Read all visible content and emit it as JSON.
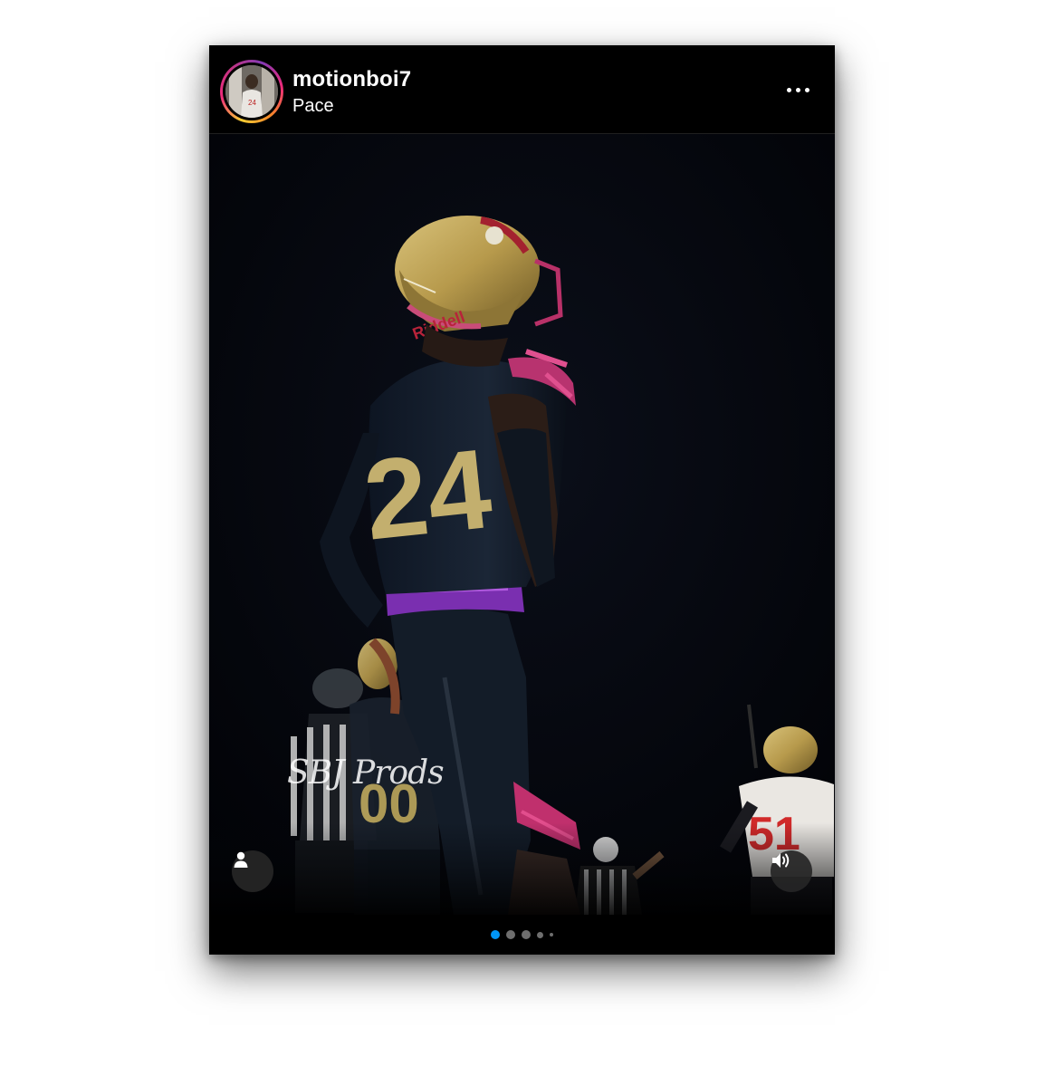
{
  "post": {
    "username": "motionboi7",
    "subtitle": "Pace",
    "more_icon": "more-horizontal-icon",
    "media": {
      "watermark": "SBJ Prods",
      "jersey_number": "24"
    },
    "tag_icon": "user-tag-icon",
    "sound_icon": "speaker-icon",
    "carousel": {
      "total": 5,
      "active_index": 0,
      "active_color": "#0095f6",
      "inactive_color": "#6e6e6e"
    }
  },
  "colors": {
    "background": "#000000",
    "text": "#ffffff"
  }
}
